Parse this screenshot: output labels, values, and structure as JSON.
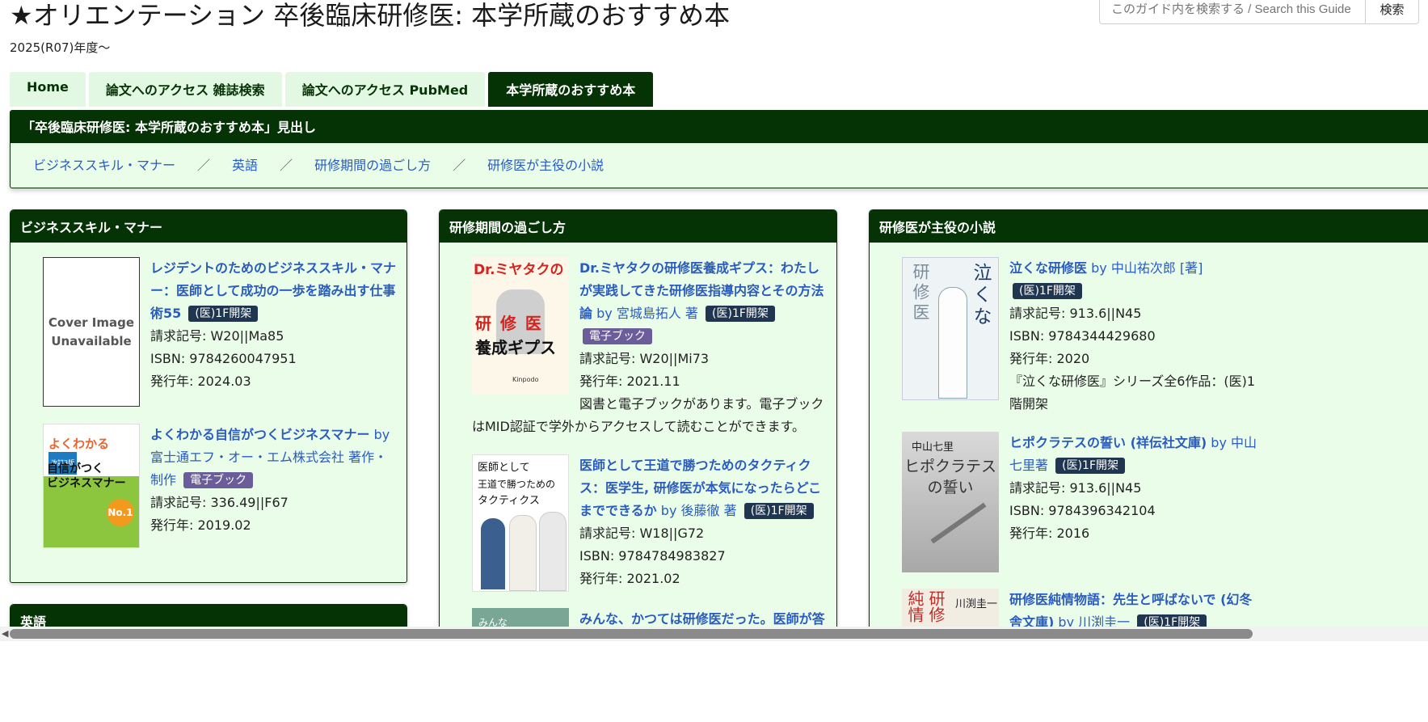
{
  "page": {
    "title": "★オリエンテーション 卒後臨床研修医: 本学所蔵のおすすめ本",
    "subtitle": "2025(R07)年度〜"
  },
  "search": {
    "placeholder": "このガイド内を検索する / Search this Guide",
    "button": "検索"
  },
  "tabs": [
    {
      "label": "Home"
    },
    {
      "label": "論文へのアクセス 雑誌検索"
    },
    {
      "label": "論文へのアクセス PubMed"
    },
    {
      "label": "本学所蔵のおすすめ本"
    }
  ],
  "outline": {
    "heading": "「卒後臨床研修医: 本学所蔵のおすすめ本」見出し",
    "links": [
      "ビジネススキル・マナー",
      "英語",
      "研修期間の過ごし方",
      "研修医が主役の小説"
    ],
    "separator": "／"
  },
  "labels": {
    "cover_unavailable_1": "Cover Image",
    "cover_unavailable_2": "Unavailable",
    "by": "by",
    "shelf_badge": "(医)1F開架",
    "ebook_badge": "電子ブック"
  },
  "boxes": {
    "business": {
      "heading": "ビジネススキル・マナー",
      "books": [
        {
          "title": "レジデントのためのビジネススキル・マナー：医師として成功の一歩を踏み出す仕事術55",
          "call": "請求記号: W20||Ma85",
          "isbn": "ISBN: 9784260047951",
          "year": "発行年: 2024.03"
        },
        {
          "title": "よくわかる自信がつくビジネスマナー",
          "author": "富士通エフ・オー・エム株式会社 著作・制作",
          "call": "請求記号: 336.49||F67",
          "year": "発行年: 2019.02",
          "cover": {
            "line1": "よくわかる",
            "tag": "改訂3版",
            "line2": "自信がつく",
            "line3": "ビジネスマナー",
            "no1": "No.1"
          }
        }
      ]
    },
    "english": {
      "heading": "英語"
    },
    "training": {
      "heading": "研修期間の過ごし方",
      "books": [
        {
          "title": "Dr.ミヤタクの研修医養成ギプス：わたしが実践してきた研修医指導内容とその方法論",
          "author": "宮城島拓人 著",
          "call": "請求記号: W20||Mi73",
          "year": "発行年: 2021.11",
          "note": "図書と電子ブックがあります。電子ブックはMID認証で学外からアクセスして読むことができます。",
          "cover": {
            "top": "Dr.ミヤタクの",
            "mid": "研 修 医",
            "bottom": "養成ギプス",
            "pub": "Kinpodo"
          }
        },
        {
          "title": "医師として王道で勝つためのタクティクス：医学生, 研修医が本気になったらどこまでできるか",
          "author": "後藤徹 著",
          "call": "請求記号: W18||G72",
          "isbn": "ISBN: 9784784983827",
          "year": "発行年: 2021.02",
          "cover": {
            "line1": "医師として",
            "line2": "王道で勝つための",
            "line3": "タクティクス"
          }
        },
        {
          "title": "みんな、かつては研修医だった。医師が答",
          "cover": {
            "line1": "みんな"
          }
        }
      ]
    },
    "novels": {
      "heading": "研修医が主役の小説",
      "books": [
        {
          "title": "泣くな研修医",
          "author": "中山祐次郎 [著]",
          "call": "請求記号: 913.6||N45",
          "isbn": "ISBN: 9784344429680",
          "year": "発行年: 2020",
          "note": "『泣くな研修医』シリーズ全6作品：(医)1階開架",
          "cover": {
            "a": "泣くな",
            "b": "研修医"
          }
        },
        {
          "title": "ヒポクラテスの誓い (祥伝社文庫)",
          "author": "中山七里著",
          "call": "請求記号: 913.6||N45",
          "isbn": "ISBN: 9784396342104",
          "year": "発行年: 2016",
          "cover": {
            "author": "中山七里",
            "t1": "ヒポクラテス",
            "t2": "の誓い"
          }
        },
        {
          "title": "研修医純情物語：先生と呼ばないで (幻冬舎文庫)",
          "author": "川渕圭一",
          "cover": {
            "a": "純情",
            "b": "研修",
            "author": "川渕圭一"
          }
        }
      ]
    }
  },
  "colors": {
    "header_green": "#063306",
    "box_bg": "#eafde9",
    "link_blue": "#2a5bbf",
    "shelf_badge": "#1f3550",
    "ebook_badge": "#6b5c9a"
  }
}
